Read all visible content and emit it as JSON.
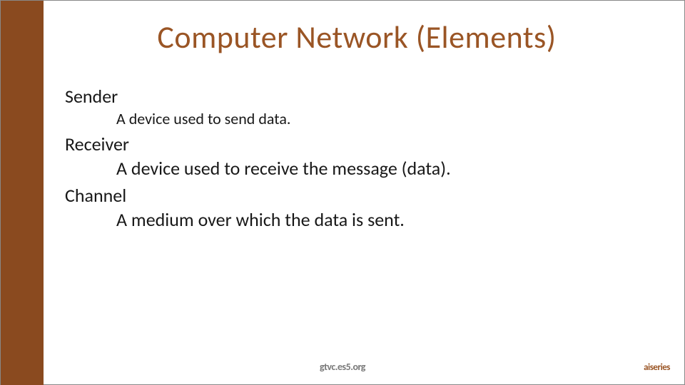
{
  "title": "Computer Network (Elements)",
  "items": [
    {
      "term": "Sender",
      "definition": "A device used to send data.",
      "big": false
    },
    {
      "term": "Receiver",
      "definition": "A device used to receive the message (data).",
      "big": true
    },
    {
      "term": "Channel",
      "definition": "A medium over which the data is sent.",
      "big": true
    }
  ],
  "footer_center": "gtvc.es5.org",
  "footer_right": "aiseries",
  "colors": {
    "accent": "#8a4a1f",
    "title": "#9a5525"
  }
}
